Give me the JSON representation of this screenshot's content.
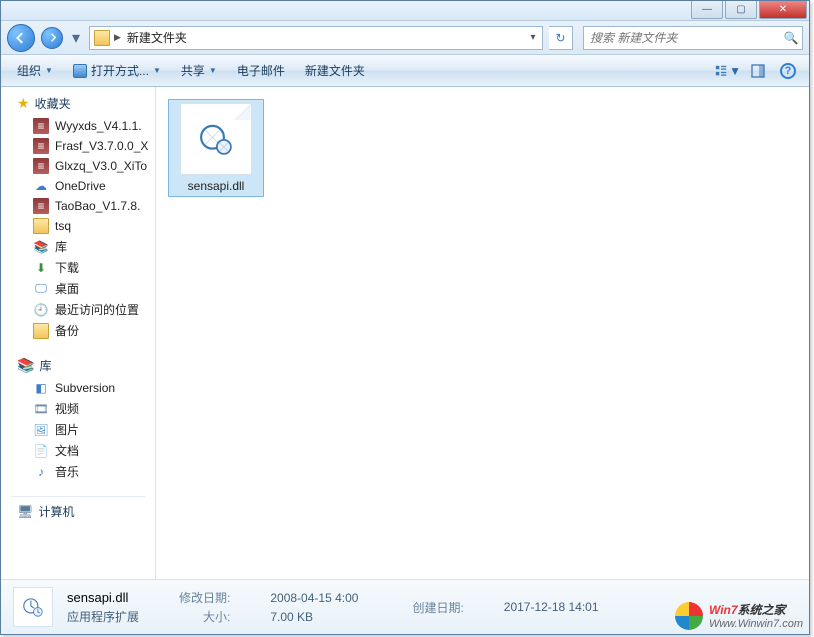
{
  "titlebar": {
    "minimize": "—",
    "maximize": "▢",
    "close": "✕"
  },
  "nav": {
    "breadcrumb_root": "▶",
    "breadcrumb_current": "新建文件夹",
    "search_placeholder": "搜索 新建文件夹"
  },
  "toolbar": {
    "organize": "组织",
    "open_with": "打开方式...",
    "share": "共享",
    "email": "电子邮件",
    "new_folder": "新建文件夹"
  },
  "sidebar": {
    "favorites_label": "收藏夹",
    "favorites": [
      {
        "label": "Wyyxds_V4.1.1.",
        "icon": "rar"
      },
      {
        "label": "Frasf_V3.7.0.0_X",
        "icon": "rar"
      },
      {
        "label": "Glxzq_V3.0_XiTo",
        "icon": "rar"
      },
      {
        "label": "OneDrive",
        "icon": "cloud"
      },
      {
        "label": "TaoBao_V1.7.8.",
        "icon": "rar"
      },
      {
        "label": "tsq",
        "icon": "folder"
      },
      {
        "label": "库",
        "icon": "lib"
      },
      {
        "label": "下载",
        "icon": "down"
      },
      {
        "label": "桌面",
        "icon": "desk"
      },
      {
        "label": "最近访问的位置",
        "icon": "recent"
      },
      {
        "label": "备份",
        "icon": "folder"
      }
    ],
    "libraries_label": "库",
    "libraries": [
      {
        "label": "Subversion",
        "icon": "svn"
      },
      {
        "label": "视频",
        "icon": "vid"
      },
      {
        "label": "图片",
        "icon": "pic"
      },
      {
        "label": "文档",
        "icon": "doc"
      },
      {
        "label": "音乐",
        "icon": "mus"
      }
    ],
    "computer_label": "计算机"
  },
  "content": {
    "files": [
      {
        "name": "sensapi.dll",
        "selected": true
      }
    ]
  },
  "details": {
    "filename": "sensapi.dll",
    "filetype": "应用程序扩展",
    "modified_label": "修改日期:",
    "modified_value": "2008-04-15 4:00",
    "size_label": "大小:",
    "size_value": "7.00 KB",
    "created_label": "创建日期:",
    "created_value": "2017-12-18 14:01"
  },
  "watermark": {
    "brand_prefix": "Win7",
    "brand_suffix": "系统之家",
    "url": "Www.Winwin7.com"
  }
}
